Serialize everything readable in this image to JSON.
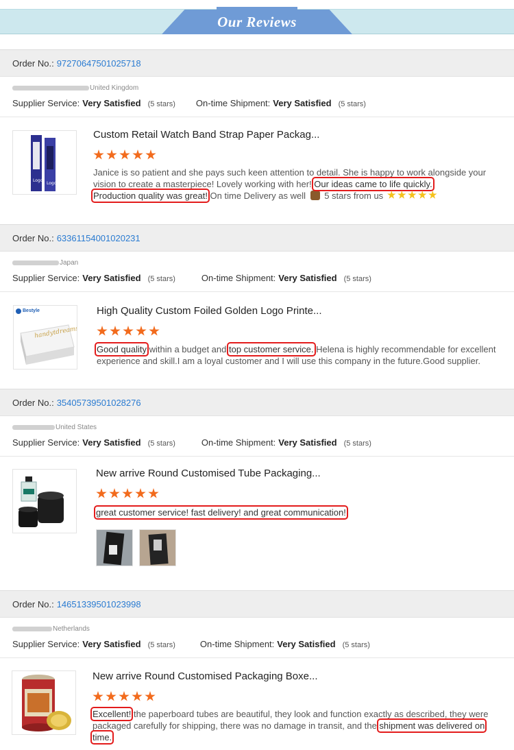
{
  "banner": {
    "title": "Our Reviews"
  },
  "labels": {
    "order_no": "Order No.:",
    "supplier_service": "Supplier Service:",
    "ontime_shipment": "On-time Shipment:"
  },
  "orders": [
    {
      "number": "97270647501025718",
      "country": "United Kingdom",
      "supplier_rating": "Very Satisfied",
      "supplier_stars": "(5 stars)",
      "shipment_rating": "Very Satisfied",
      "shipment_stars": "(5 stars)",
      "product_title": "Custom Retail Watch Band Strap Paper Packag...",
      "rating": 5,
      "review": {
        "p1": "Janice is so patient and she pays such keen attention to detail. She is happy to work alongside your vision to create a masterpiece! Lovely working with her! ",
        "h1": "Our ideas came to life quickly.",
        "h2": "Production quality was great!",
        "p2": " On time Delivery as well ",
        "p3": " 5 stars from us "
      }
    },
    {
      "number": "63361154001020231",
      "country": "Japan",
      "supplier_rating": "Very Satisfied",
      "supplier_stars": "(5 stars)",
      "shipment_rating": "Very Satisfied",
      "shipment_stars": "(5 stars)",
      "product_title": "High Quality Custom Foiled Golden Logo Printe...",
      "rating": 5,
      "thumb_brand": "Bestyle",
      "thumb_script": "handytdreams",
      "review": {
        "h1": "Good quality",
        "p1": " within a budget and ",
        "h2": "top customer service.",
        "p2": " Helena is highly recommendable for excellent experience and skill.I am a loyal customer and I will use this company in the future.Good supplier."
      }
    },
    {
      "number": "35405739501028276",
      "country": "United States",
      "supplier_rating": "Very Satisfied",
      "supplier_stars": "(5 stars)",
      "shipment_rating": "Very Satisfied",
      "shipment_stars": "(5 stars)",
      "product_title": "New arrive Round Customised Tube Packaging...",
      "rating": 5,
      "review": {
        "h1": "great customer service! fast delivery! and great communication!"
      }
    },
    {
      "number": "14651339501023998",
      "country": "Netherlands",
      "supplier_rating": "Very Satisfied",
      "supplier_stars": "(5 stars)",
      "shipment_rating": "Very Satisfied",
      "shipment_stars": "(5 stars)",
      "product_title": "New arrive Round Customised Packaging Boxe...",
      "rating": 5,
      "review": {
        "h1": "Excellent!",
        "p1": " the paperboard tubes are beautiful, they look and function exactly as described, they were packaged carefully for shipping, there was no damage in transit, and the ",
        "h2": "shipment was delivered on time."
      }
    }
  ],
  "colors": {
    "order_number": "#2a7bd1",
    "star": "#f26b1d",
    "highlight": "#e31b1b",
    "banner_tab": "#6f9bd6",
    "banner_strip": "#cde8ee"
  }
}
